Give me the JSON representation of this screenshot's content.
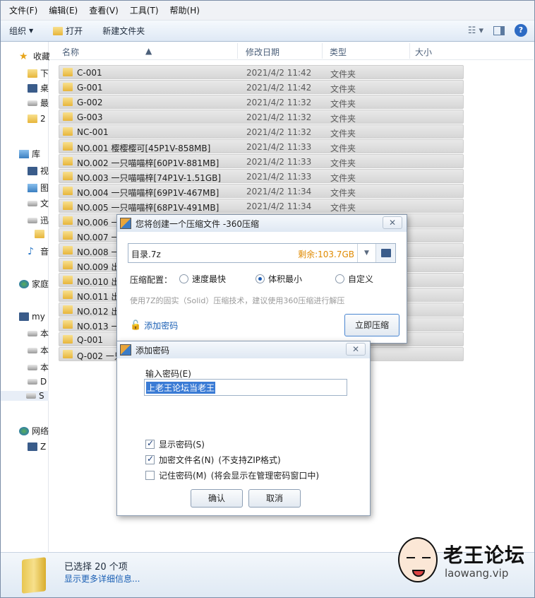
{
  "menubar": [
    "文件(F)",
    "编辑(E)",
    "查看(V)",
    "工具(T)",
    "帮助(H)"
  ],
  "toolbar": {
    "organize": "组织",
    "open": "打开",
    "new_folder": "新建文件夹"
  },
  "nav": {
    "items": [
      {
        "label": "收藏",
        "icon": "star-icon"
      },
      {
        "label": "下",
        "icon": "folder-icon"
      },
      {
        "label": "桌",
        "icon": "desktop-icon"
      },
      {
        "label": "最",
        "icon": "recent-icon"
      },
      {
        "label": "2",
        "icon": "folder-icon"
      },
      {
        "label": "库",
        "icon": "library-icon"
      },
      {
        "label": "视",
        "icon": "video-icon"
      },
      {
        "label": "图",
        "icon": "picture-icon"
      },
      {
        "label": "文",
        "icon": "document-icon"
      },
      {
        "label": "迅",
        "icon": "download-icon"
      },
      {
        "label": "",
        "icon": "folder-icon"
      },
      {
        "label": "音",
        "icon": "music-icon"
      },
      {
        "label": "家庭",
        "icon": "homegroup-icon"
      },
      {
        "label": "my",
        "icon": "computer-icon"
      },
      {
        "label": "本",
        "icon": "drive-icon"
      },
      {
        "label": "本",
        "icon": "drive-icon"
      },
      {
        "label": "本",
        "icon": "drive-icon"
      },
      {
        "label": "D",
        "icon": "drive-icon"
      },
      {
        "label": "S",
        "icon": "drive-icon"
      },
      {
        "label": "网络",
        "icon": "network-icon"
      },
      {
        "label": "Z",
        "icon": "computer-icon"
      }
    ]
  },
  "columns": {
    "name": "名称",
    "date": "修改日期",
    "type": "类型",
    "size": "大小"
  },
  "files": [
    {
      "name": "C-001",
      "date": "2021/4/2 11:42",
      "type": "文件夹"
    },
    {
      "name": "G-001",
      "date": "2021/4/2 11:42",
      "type": "文件夹"
    },
    {
      "name": "G-002",
      "date": "2021/4/2 11:32",
      "type": "文件夹"
    },
    {
      "name": "G-003",
      "date": "2021/4/2 11:32",
      "type": "文件夹"
    },
    {
      "name": "NC-001",
      "date": "2021/4/2 11:32",
      "type": "文件夹"
    },
    {
      "name": "NO.001 樱樱樱可[45P1V-858MB]",
      "date": "2021/4/2 11:33",
      "type": "文件夹"
    },
    {
      "name": "NO.002 一只喵喵梓[60P1V-881MB]",
      "date": "2021/4/2 11:33",
      "type": "文件夹"
    },
    {
      "name": "NO.003 一只喵喵梓[74P1V-1.51GB]",
      "date": "2021/4/2 11:33",
      "type": "文件夹"
    },
    {
      "name": "NO.004 一只喵喵梓[69P1V-467MB]",
      "date": "2021/4/2 11:34",
      "type": "文件夹"
    },
    {
      "name": "NO.005 一只喵喵梓[68P1V-491MB]",
      "date": "2021/4/2 11:34",
      "type": "文件夹"
    },
    {
      "name": "NO.006 一",
      "date": "",
      "type": ""
    },
    {
      "name": "NO.007 一",
      "date": "",
      "type": ""
    },
    {
      "name": "NO.008 一",
      "date": "",
      "type": ""
    },
    {
      "name": "NO.009 出",
      "date": "",
      "type": ""
    },
    {
      "name": "NO.010 出",
      "date": "",
      "type": ""
    },
    {
      "name": "NO.011 出",
      "date": "",
      "type": ""
    },
    {
      "name": "NO.012 出",
      "date": "",
      "type": ""
    },
    {
      "name": "NO.013 一",
      "date": "",
      "type": ""
    },
    {
      "name": "Q-001",
      "date": "",
      "type": ""
    },
    {
      "name": "Q-002 一只",
      "date": "",
      "type": ""
    }
  ],
  "status": {
    "count": "已选择 20 个项",
    "link": "显示更多详细信息..."
  },
  "watermark": {
    "title": "老王论坛",
    "url": "laowang.vip"
  },
  "compress_dialog": {
    "title": "您将创建一个压缩文件 -360压缩",
    "filename": "目录.7z",
    "remaining": "剩余:103.7GB",
    "config_label": "压缩配置：",
    "options": [
      "速度最快",
      "体积最小",
      "自定义"
    ],
    "selected_option": "体积最小",
    "hint": "使用7Z的固实（Solid）压缩技术，建议使用360压缩进行解压",
    "add_password": "添加密码",
    "compress_button": "立即压缩"
  },
  "password_dialog": {
    "title": "添加密码",
    "input_label": "输入密码(E)",
    "password_value": "上老王论坛当老王",
    "show_password": "显示密码(S)",
    "encrypt_names": "加密文件名(N)",
    "encrypt_names_note": "(不支持ZIP格式)",
    "remember_password": "记住密码(M)",
    "remember_note": "(将会显示在管理密码窗口中)",
    "ok": "确认",
    "cancel": "取消"
  },
  "colors": {
    "accent": "#1e5cb3",
    "remaining": "#e08a00",
    "selection": "#3a7bd5"
  }
}
